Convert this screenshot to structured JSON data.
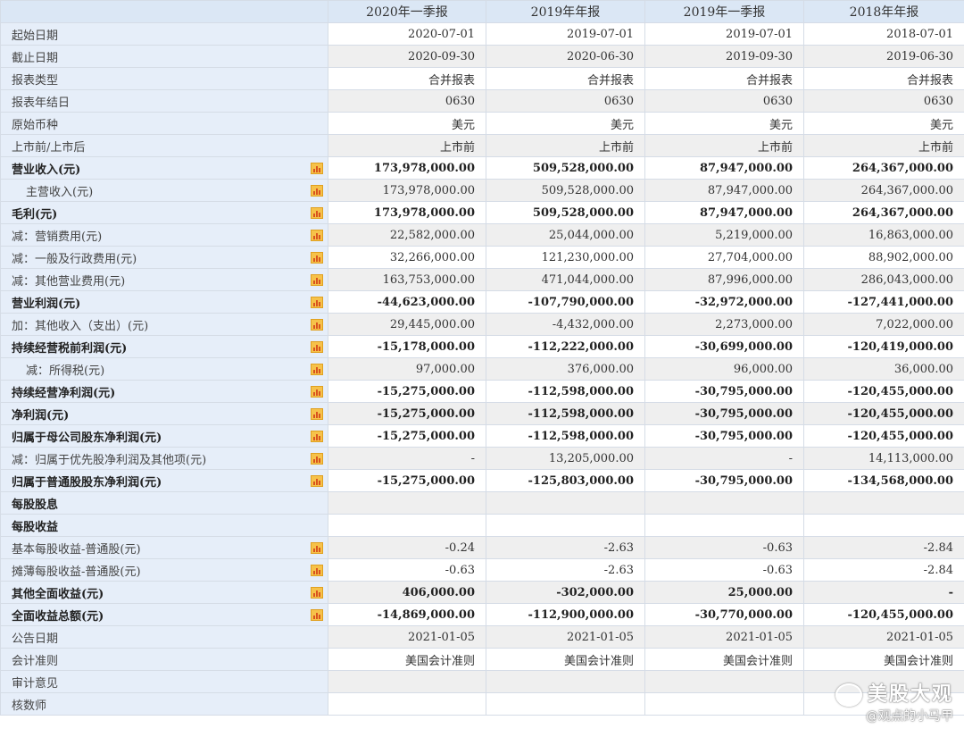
{
  "header": [
    "",
    "2020年一季报",
    "2019年年报",
    "2019年一季报",
    "2018年年报"
  ],
  "rows": [
    {
      "label": "起始日期",
      "values": [
        "2020-07-01",
        "2019-07-01",
        "2019-07-01",
        "2018-07-01"
      ]
    },
    {
      "label": "截止日期",
      "values": [
        "2020-09-30",
        "2020-06-30",
        "2019-09-30",
        "2019-06-30"
      ]
    },
    {
      "label": "报表类型",
      "values": [
        "合并报表",
        "合并报表",
        "合并报表",
        "合并报表"
      ]
    },
    {
      "label": "报表年结日",
      "values": [
        "0630",
        "0630",
        "0630",
        "0630"
      ]
    },
    {
      "label": "原始币种",
      "values": [
        "美元",
        "美元",
        "美元",
        "美元"
      ]
    },
    {
      "label": "上市前/上市后",
      "values": [
        "上市前",
        "上市前",
        "上市前",
        "上市前"
      ]
    },
    {
      "label": "营业收入(元)",
      "values": [
        "173,978,000.00",
        "509,528,000.00",
        "87,947,000.00",
        "264,367,000.00"
      ],
      "bold": true,
      "icon": true
    },
    {
      "label": "主营收入(元)",
      "values": [
        "173,978,000.00",
        "509,528,000.00",
        "87,947,000.00",
        "264,367,000.00"
      ],
      "indent": true,
      "icon": true
    },
    {
      "label": "毛利(元)",
      "values": [
        "173,978,000.00",
        "509,528,000.00",
        "87,947,000.00",
        "264,367,000.00"
      ],
      "bold": true,
      "icon": true
    },
    {
      "label": "减：营销费用(元)",
      "values": [
        "22,582,000.00",
        "25,044,000.00",
        "5,219,000.00",
        "16,863,000.00"
      ],
      "icon": true
    },
    {
      "label": "减：一般及行政费用(元)",
      "values": [
        "32,266,000.00",
        "121,230,000.00",
        "27,704,000.00",
        "88,902,000.00"
      ],
      "icon": true
    },
    {
      "label": "减：其他营业费用(元)",
      "values": [
        "163,753,000.00",
        "471,044,000.00",
        "87,996,000.00",
        "286,043,000.00"
      ],
      "icon": true
    },
    {
      "label": "营业利润(元)",
      "values": [
        "-44,623,000.00",
        "-107,790,000.00",
        "-32,972,000.00",
        "-127,441,000.00"
      ],
      "bold": true,
      "icon": true
    },
    {
      "label": "加：其他收入（支出）(元)",
      "values": [
        "29,445,000.00",
        "-4,432,000.00",
        "2,273,000.00",
        "7,022,000.00"
      ],
      "icon": true
    },
    {
      "label": "持续经营税前利润(元)",
      "values": [
        "-15,178,000.00",
        "-112,222,000.00",
        "-30,699,000.00",
        "-120,419,000.00"
      ],
      "bold": true,
      "icon": true
    },
    {
      "label": "减：所得税(元)",
      "values": [
        "97,000.00",
        "376,000.00",
        "96,000.00",
        "36,000.00"
      ],
      "indent": true,
      "icon": true
    },
    {
      "label": "持续经营净利润(元)",
      "values": [
        "-15,275,000.00",
        "-112,598,000.00",
        "-30,795,000.00",
        "-120,455,000.00"
      ],
      "bold": true,
      "icon": true
    },
    {
      "label": "净利润(元)",
      "values": [
        "-15,275,000.00",
        "-112,598,000.00",
        "-30,795,000.00",
        "-120,455,000.00"
      ],
      "bold": true,
      "icon": true
    },
    {
      "label": "归属于母公司股东净利润(元)",
      "values": [
        "-15,275,000.00",
        "-112,598,000.00",
        "-30,795,000.00",
        "-120,455,000.00"
      ],
      "bold": true,
      "icon": true
    },
    {
      "label": "减：归属于优先股净利润及其他项(元)",
      "values": [
        "-",
        "13,205,000.00",
        "-",
        "14,113,000.00"
      ],
      "icon": true
    },
    {
      "label": "归属于普通股股东净利润(元)",
      "values": [
        "-15,275,000.00",
        "-125,803,000.00",
        "-30,795,000.00",
        "-134,568,000.00"
      ],
      "bold": true,
      "icon": true
    },
    {
      "label": "每股股息",
      "values": [
        "",
        "",
        "",
        ""
      ],
      "bold": true
    },
    {
      "label": "每股收益",
      "values": [
        "",
        "",
        "",
        ""
      ],
      "bold": true
    },
    {
      "label": "基本每股收益-普通股(元)",
      "values": [
        "-0.24",
        "-2.63",
        "-0.63",
        "-2.84"
      ],
      "icon": true
    },
    {
      "label": "摊薄每股收益-普通股(元)",
      "values": [
        "-0.63",
        "-2.63",
        "-0.63",
        "-2.84"
      ],
      "icon": true
    },
    {
      "label": "其他全面收益(元)",
      "values": [
        "406,000.00",
        "-302,000.00",
        "25,000.00",
        "-"
      ],
      "bold": true,
      "icon": true
    },
    {
      "label": "全面收益总额(元)",
      "values": [
        "-14,869,000.00",
        "-112,900,000.00",
        "-30,770,000.00",
        "-120,455,000.00"
      ],
      "bold": true,
      "icon": true
    },
    {
      "label": "公告日期",
      "values": [
        "2021-01-05",
        "2021-01-05",
        "2021-01-05",
        "2021-01-05"
      ]
    },
    {
      "label": "会计准则",
      "values": [
        "美国会计准则",
        "美国会计准则",
        "美国会计准则",
        "美国会计准则"
      ]
    },
    {
      "label": "审计意见",
      "values": [
        "",
        "",
        "",
        ""
      ]
    },
    {
      "label": "核数师",
      "values": [
        "",
        "",
        "",
        ""
      ]
    }
  ],
  "watermark": {
    "line1": "美股大观",
    "line2": "@观点的小马甲"
  }
}
